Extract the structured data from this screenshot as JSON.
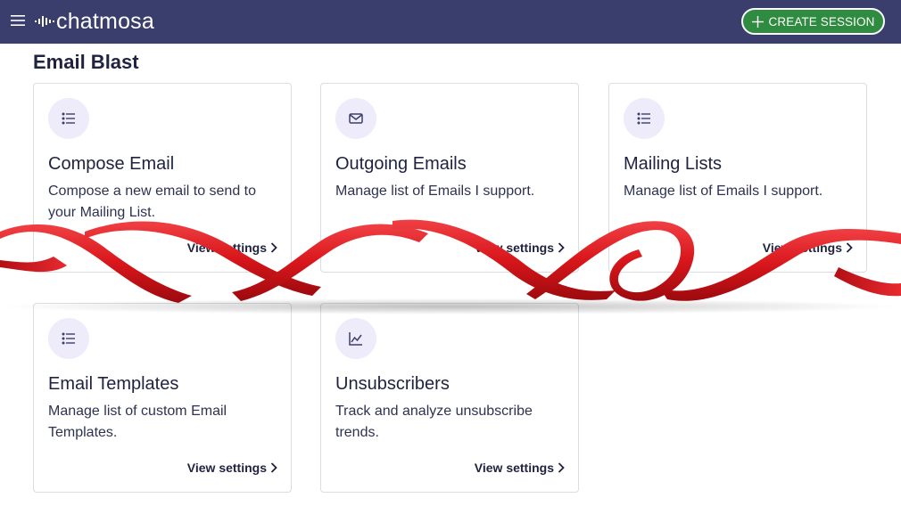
{
  "header": {
    "logo_text": "chatmosa",
    "create_button_label": "CREATE SESSION"
  },
  "page": {
    "title": "Email Blast"
  },
  "cards": [
    {
      "icon": "list-icon",
      "title": "Compose Email",
      "description": "Compose a new email to send to your Mailing List.",
      "link": "View settings"
    },
    {
      "icon": "envelope-icon",
      "title": "Outgoing Emails",
      "description": "Manage list of Emails I support.",
      "link": "View settings"
    },
    {
      "icon": "list-icon",
      "title": "Mailing Lists",
      "description": "Manage list of Emails I support.",
      "link": "View settings"
    },
    {
      "icon": "list-icon",
      "title": "Email Templates",
      "description": "Manage list of custom Email Templates.",
      "link": "View settings"
    },
    {
      "icon": "chart-line-icon",
      "title": "Unsubscribers",
      "description": "Track and analyze unsubscribe trends.",
      "link": "View settings"
    }
  ],
  "colors": {
    "topbar": "#3a3e6d",
    "create_button": "#2e8b3f",
    "icon_bg": "#eeebfa",
    "ribbon": "#d8161b"
  }
}
